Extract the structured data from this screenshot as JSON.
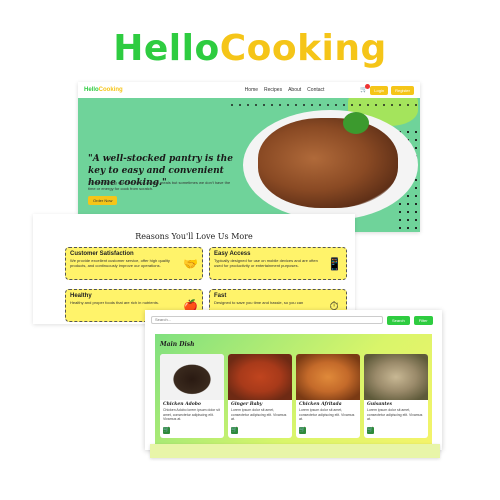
{
  "brand": {
    "hello": "Hello",
    "cooking": "Cooking"
  },
  "landing": {
    "logo_hello": "Hello",
    "logo_cooking": "Cooking",
    "nav": [
      "Home",
      "Recipes",
      "About",
      "Contact"
    ],
    "cart_icon": "cart-icon",
    "login_label": "Login",
    "register_label": "Register",
    "hero_quote": "\"A well-stocked pantry is the key to easy and convenient home cooking.\"",
    "hero_sub": "There is nothing quite like home-cooked meals but sometimes we don't have the time or energy for cook from scratch.",
    "order_label": "Order Now"
  },
  "reasons": {
    "title": "Reasons You'll Love Us More",
    "cards": [
      {
        "title": "Customer Satisfaction",
        "desc": "We provide excellent customer service, offer high quality products, and continuously improve our operations.",
        "icon": "handshake-icon"
      },
      {
        "title": "Easy Access",
        "desc": "Typically designed for use on mobile devices and are often used for productivity or entertainment purposes.",
        "icon": "phone-icon"
      },
      {
        "title": "Healthy",
        "desc": "Healthy and proper foods that are rich in nutrients.",
        "icon": "apple-icon"
      },
      {
        "title": "Fast",
        "desc": "Designed to save you time and hassle, so you can",
        "icon": "clock-icon"
      }
    ]
  },
  "dishes": {
    "search_placeholder": "Search...",
    "search_label": "Search",
    "filter_label": "Filter",
    "section_title": "Main Dish",
    "items": [
      {
        "name": "Chicken Adobo",
        "desc": "Chicken Adobo lorem ipsum dolor sit amet, consectetur adipiscing elit. Vivamus at.",
        "color": "#3a2a1e"
      },
      {
        "name": "Ginger Baby",
        "desc": "Lorem ipsum dolor sit amet, consectetur adipiscing elit. Vivamus at.",
        "color": "#a83a1a"
      },
      {
        "name": "Chicken Afritada",
        "desc": "Lorem ipsum dolor sit amet, consectetur adipiscing elit. Vivamus at.",
        "color": "#c46a2a"
      },
      {
        "name": "Guisantes",
        "desc": "Lorem ipsum dolor sit amet, consectetur adipiscing elit. Vivamus at.",
        "color": "#9a8a6a"
      }
    ]
  }
}
